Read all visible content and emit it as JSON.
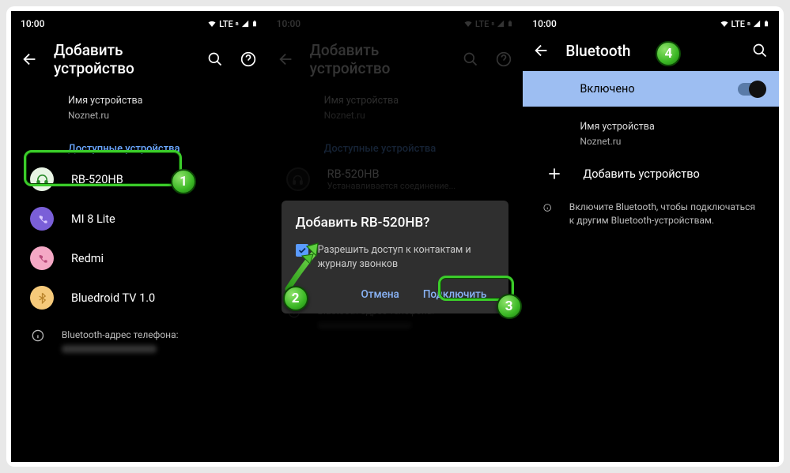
{
  "status": {
    "time": "10:00",
    "net": "LTE"
  },
  "screen1": {
    "title": "Добавить устройство",
    "deviceNameLabel": "Имя устройства",
    "deviceName": "Noznet.ru",
    "availableLabel": "Доступные устройства",
    "devices": [
      {
        "name": "RB-520HB",
        "color": "#e8f4e4",
        "icon": "headphones",
        "iconColor": "#2a8a2a"
      },
      {
        "name": "MI 8 Lite",
        "color": "#7a5fd8",
        "icon": "phone",
        "iconColor": "#d9c8ff"
      },
      {
        "name": "Redmi",
        "color": "#f4a8c5",
        "icon": "phone",
        "iconColor": "#b84a7a"
      },
      {
        "name": "Bluedroid TV 1.0",
        "color": "#f5c97a",
        "icon": "bluetooth",
        "iconColor": "#b8832a"
      }
    ],
    "addressLabel": "Bluetooth-адрес телефона:"
  },
  "screen2": {
    "title": "Добавить устройство",
    "deviceNameLabel": "Имя устройства",
    "deviceName": "Noznet.ru",
    "availableLabel": "Доступные устройства",
    "connectingDevice": "RB-520HB",
    "connectingStatus": "Устанавливается соединение...",
    "dialog": {
      "title": "Добавить RB-520HB?",
      "checkboxText": "Разрешить доступ к контактам и журналу звонков",
      "cancel": "Отмена",
      "connect": "Подключить"
    },
    "addressLabel": "Bluetooth-адрес телефона:"
  },
  "screen3": {
    "title": "Bluetooth",
    "enabled": "Включено",
    "deviceNameLabel": "Имя устройства",
    "deviceName": "Noznet.ru",
    "addDevice": "Добавить устройство",
    "hint": "Включите Bluetooth, чтобы подключаться к другим Bluetooth-устройствам."
  },
  "badges": {
    "b1": "1",
    "b2": "2",
    "b3": "3",
    "b4": "4"
  }
}
